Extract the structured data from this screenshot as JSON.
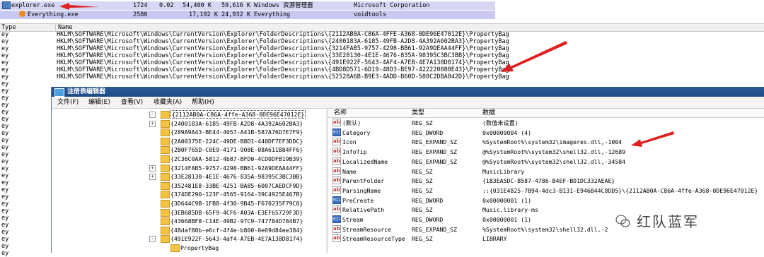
{
  "process_rows": [
    {
      "name": "explorer.exe",
      "pid": "1724",
      "cpu": "0.02",
      "private": "54,400 K",
      "working": "59,616 K",
      "desc": "Windows 资源管理器",
      "company": "Microsoft Corporation"
    },
    {
      "name": "Everything.exe",
      "pid": "2580",
      "cpu": "",
      "private": "17,192 K",
      "working": "24,932 K",
      "desc": "Everything",
      "company": "voidtools"
    }
  ],
  "results_header": {
    "type": "Type",
    "name": "Name"
  },
  "results": [
    {
      "type": "ey",
      "name": "HKLM\\SOFTWARE\\Microsoft\\Windows\\CurrentVersion\\Explorer\\FolderDescriptions\\{2112AB0A-C86A-4FFE-A368-0DE96E47012E}\\PropertyBag"
    },
    {
      "type": "ey",
      "name": "HKLM\\SOFTWARE\\Microsoft\\Windows\\CurrentVersion\\Explorer\\FolderDescriptions\\{2400183A-6185-49FB-A2D8-4A392A602BA3}\\PropertyBag"
    },
    {
      "type": "ey",
      "name": "HKLM\\SOFTWARE\\Microsoft\\Windows\\CurrentVersion\\Explorer\\FolderDescriptions\\{3214FAB5-9757-4298-BB61-92A9DEAA44FF}\\PropertyBag"
    },
    {
      "type": "ey",
      "name": "HKLM\\SOFTWARE\\Microsoft\\Windows\\CurrentVersion\\Explorer\\FolderDescriptions\\{33E28130-4E1E-4676-835A-98395C3BC3BB}\\PropertyBag"
    },
    {
      "type": "ey",
      "name": "HKLM\\SOFTWARE\\Microsoft\\Windows\\CurrentVersion\\Explorer\\FolderDescriptions\\{491E922F-5643-4AF4-A7EB-4E7A138D8174}\\PropertyBag"
    },
    {
      "type": "ey",
      "name": "HKLM\\SOFTWARE\\Microsoft\\Windows\\CurrentVersion\\Explorer\\FolderDescriptions\\{4BD8D571-6D19-48D3-BE97-422220080E43}\\PropertyBag"
    },
    {
      "type": "ey",
      "name": "HKLM\\SOFTWARE\\Microsoft\\Windows\\CurrentVersion\\Explorer\\FolderDescriptions\\{52528A6B-B9E3-4ADD-B60D-588C2DBA842D}\\PropertyBag"
    },
    {
      "type": "ey",
      "name": ""
    },
    {
      "type": "ey",
      "name": ""
    },
    {
      "type": "ey",
      "name": ""
    },
    {
      "type": "ey",
      "name": ""
    },
    {
      "type": "ey",
      "name": ""
    },
    {
      "type": "ey",
      "name": ""
    },
    {
      "type": "ey",
      "name": ""
    },
    {
      "type": "ey",
      "name": ""
    },
    {
      "type": "ey",
      "name": ""
    },
    {
      "type": "ey",
      "name": ""
    },
    {
      "type": "ey",
      "name": ""
    },
    {
      "type": "ey",
      "name": ""
    },
    {
      "type": "ey",
      "name": ""
    },
    {
      "type": "ey",
      "name": ""
    },
    {
      "type": "ey",
      "name": ""
    },
    {
      "type": "ey",
      "name": ""
    },
    {
      "type": "ey",
      "name": ""
    },
    {
      "type": "ey",
      "name": ""
    },
    {
      "type": "ey",
      "name": ""
    },
    {
      "type": "ey",
      "name": ""
    },
    {
      "type": "ey",
      "name": ""
    },
    {
      "type": "ey",
      "name": ""
    },
    {
      "type": "ey",
      "name": ""
    },
    {
      "type": "ey",
      "name": ""
    },
    {
      "type": "ey",
      "name": ""
    }
  ],
  "regedit": {
    "title": "注册表编辑器",
    "menu": [
      "文件(F)",
      "编辑(E)",
      "查看(V)",
      "收藏夹(A)",
      "帮助(H)"
    ],
    "tree": [
      {
        "label": "{2112AB0A-C86A-4ffe-A368-0DE96E47012E}",
        "selected": true,
        "expander": "-"
      },
      {
        "label": "{2400183A-6185-49FB-A2D8-4A392A602BA3}",
        "expander": "+"
      },
      {
        "label": "{289A9A43-BE44-4057-A41B-587A76D7E7F9}",
        "expander": ""
      },
      {
        "label": "{2A00375E-224C-49DE-B8D1-440DF7EF3DDC}",
        "expander": ""
      },
      {
        "label": "{2B0F765D-C0E9-4171-908E-08A611B84FF6}",
        "expander": ""
      },
      {
        "label": "{2C36C0AA-5812-4b87-BFD0-4CD0DFB19B39}",
        "expander": ""
      },
      {
        "label": "{3214FAB5-9757-4298-BB61-92A9DEAA44FF}",
        "expander": "+"
      },
      {
        "label": "{33E28130-4E1E-4676-835A-98395C3BC3BB}",
        "expander": "+"
      },
      {
        "label": "{352481E8-33BE-4251-BA85-6007CAEDCF9D}",
        "expander": ""
      },
      {
        "label": "{374DE290-123F-4565-9164-39C4925E467B}",
        "expander": ""
      },
      {
        "label": "{3D644C9B-1FB8-4f30-9B45-F670235F79C0}",
        "expander": ""
      },
      {
        "label": "{3EB685DB-65F9-4CF6-A03A-E3EF65729F3D}",
        "expander": ""
      },
      {
        "label": "{43668BF8-C14E-49B2-97C9-747784D784B7}",
        "expander": ""
      },
      {
        "label": "{48daf80b-e6cf-4f4e-b800-0e69d84ee384}",
        "expander": ""
      },
      {
        "label": "{491E922F-5643-4af4-A7EB-4E7A138D8174}",
        "expander": "-"
      },
      {
        "label": "PropertyBag",
        "expander": "",
        "child": true
      }
    ],
    "list_header": {
      "name": "名称",
      "type": "类型",
      "data": "数据"
    },
    "values": [
      {
        "icon": "ab",
        "name": "(默认)",
        "type": "REG_SZ",
        "data": "(数值未设置)"
      },
      {
        "icon": "bin",
        "name": "Category",
        "type": "REG_DWORD",
        "data": "0x00000004 (4)"
      },
      {
        "icon": "ab",
        "name": "Icon",
        "type": "REG_EXPAND_SZ",
        "data": "%SystemRoot%\\system32\\imageres.dll,-1004"
      },
      {
        "icon": "ab",
        "name": "InfoTip",
        "type": "REG_EXPAND_SZ",
        "data": "@%SystemRoot%\\system32\\shell32.dll,-12689"
      },
      {
        "icon": "ab",
        "name": "LocalizedName",
        "type": "REG_EXPAND_SZ",
        "data": "@%SystemRoot%\\system32\\shell32.dll,-34584"
      },
      {
        "icon": "ab",
        "name": "Name",
        "type": "REG_SZ",
        "data": "MusicLibrary"
      },
      {
        "icon": "ab",
        "name": "ParentFolder",
        "type": "REG_SZ",
        "data": "{1B3EA5DC-B587-4786-B4EF-BD1DC332AEAE}"
      },
      {
        "icon": "ab",
        "name": "ParsingName",
        "type": "REG_SZ",
        "data": "::{031E4825-7B94-4dc3-B131-E946B44C8DD5}\\{2112AB0A-C86A-4ffe-A368-0DE96E47012E}"
      },
      {
        "icon": "bin",
        "name": "PreCreate",
        "type": "REG_DWORD",
        "data": "0x00000001 (1)"
      },
      {
        "icon": "ab",
        "name": "RelativePath",
        "type": "REG_SZ",
        "data": "Music.library-ms"
      },
      {
        "icon": "bin",
        "name": "Stream",
        "type": "REG_DWORD",
        "data": "0x00000001 (1)"
      },
      {
        "icon": "ab",
        "name": "StreamResource",
        "type": "REG_EXPAND_SZ",
        "data": "%SystemRoot%\\system32\\shell32.dll,-2"
      },
      {
        "icon": "ab",
        "name": "StreamResourceType",
        "type": "REG_SZ",
        "data": "LIBRARY"
      }
    ]
  },
  "watermark": "红队蓝军",
  "colors": {
    "arrow": "#e02020",
    "title_bar": "#1d4a86",
    "selection": "#d6d6f5"
  }
}
